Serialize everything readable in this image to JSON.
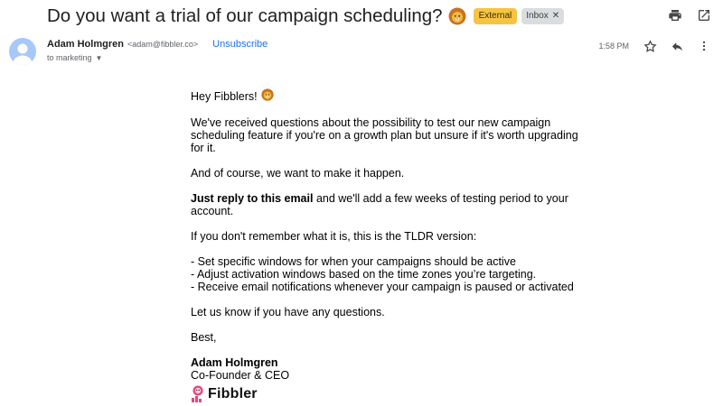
{
  "email": {
    "subject": "Do you want a trial of our campaign scheduling?",
    "labels": {
      "external": "External",
      "inbox": "Inbox"
    },
    "sender": {
      "name": "Adam Holmgren",
      "email": "<adam@fibbler.co>"
    },
    "unsubscribe": "Unsubscribe",
    "recipient": "to marketing",
    "time": "1:58 PM"
  },
  "body": {
    "greeting": "Hey Fibblers!",
    "p1": "We've received questions about the possibility to test our new campaign scheduling feature if you're on a growth plan but unsure if it's worth upgrading for it.",
    "p2": "And of course, we want to make it happen.",
    "p3_bold": "Just reply to this email",
    "p3_rest": " and we'll add a few weeks of testing period to your account.",
    "p4": "If you don't remember what it is, this is the TLDR version:",
    "bullets": [
      "-  Set specific windows for when your campaigns should be active",
      "-  Adjust activation windows based on the time zones you’re targeting.",
      "-  Receive email notifications whenever your campaign is paused or activated"
    ],
    "p5": "Let us know if you have any questions.",
    "closing": "Best,",
    "sig_name": "Adam Holmgren",
    "sig_title": "Co-Founder & CEO",
    "logo_text": "Fibbler"
  },
  "icons": {
    "print": "print-icon",
    "open_new_window": "open-in-new-window-icon",
    "star": "star-icon",
    "reply": "reply-icon",
    "more": "more-vertical-icon",
    "avatar": "person-avatar-icon",
    "lion": "lion-emoji-icon"
  },
  "colors": {
    "external_chip": "#f6c343",
    "inbox_chip": "#dadce0",
    "link": "#1a73e8",
    "avatar_bg": "#a8c7fa",
    "logo_pink": "#e8457a"
  }
}
